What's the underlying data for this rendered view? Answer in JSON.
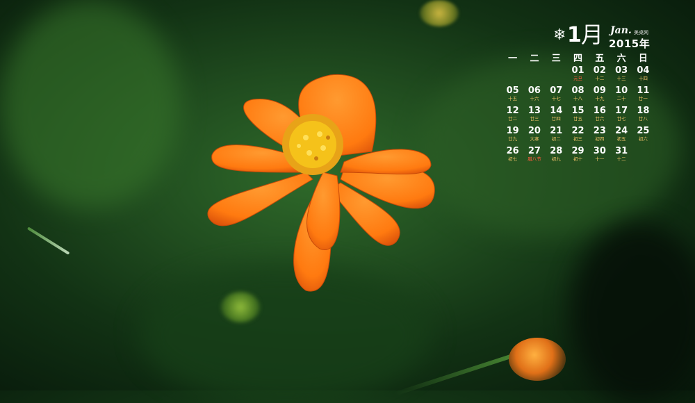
{
  "calendar": {
    "month_number": "1",
    "month_cn": "月",
    "month_en": "Jan.",
    "brand": "美桌网",
    "year": "2015年",
    "weekdays": [
      "一",
      "二",
      "三",
      "四",
      "五",
      "六",
      "日"
    ],
    "weeks": [
      [
        null,
        null,
        null,
        {
          "day": "01",
          "lunar": "元旦",
          "red": true
        },
        {
          "day": "02",
          "lunar": "十二"
        },
        {
          "day": "03",
          "lunar": "十三"
        },
        {
          "day": "04",
          "lunar": "十四"
        }
      ],
      [
        {
          "day": "05",
          "lunar": "十五"
        },
        {
          "day": "06",
          "lunar": "十六"
        },
        {
          "day": "07",
          "lunar": "十七"
        },
        {
          "day": "08",
          "lunar": "十八"
        },
        {
          "day": "09",
          "lunar": "十九"
        },
        {
          "day": "10",
          "lunar": "二十"
        },
        {
          "day": "11",
          "lunar": "廿一"
        }
      ],
      [
        {
          "day": "12",
          "lunar": "廿二"
        },
        {
          "day": "13",
          "lunar": "廿三"
        },
        {
          "day": "14",
          "lunar": "廿四"
        },
        {
          "day": "15",
          "lunar": "廿五"
        },
        {
          "day": "16",
          "lunar": "廿六"
        },
        {
          "day": "17",
          "lunar": "廿七"
        },
        {
          "day": "18",
          "lunar": "廿八"
        }
      ],
      [
        {
          "day": "19",
          "lunar": "廿九"
        },
        {
          "day": "20",
          "lunar": "大寒"
        },
        {
          "day": "21",
          "lunar": "初二"
        },
        {
          "day": "22",
          "lunar": "初三"
        },
        {
          "day": "23",
          "lunar": "初四"
        },
        {
          "day": "24",
          "lunar": "初五"
        },
        {
          "day": "25",
          "lunar": "初六"
        }
      ],
      [
        {
          "day": "26",
          "lunar": "初七"
        },
        {
          "day": "27",
          "lunar": "腊八节",
          "red": true
        },
        {
          "day": "28",
          "lunar": "初九"
        },
        {
          "day": "29",
          "lunar": "初十"
        },
        {
          "day": "30",
          "lunar": "十一"
        },
        {
          "day": "31",
          "lunar": "十二"
        },
        null
      ]
    ]
  },
  "colors": {
    "petal": "#ff7a10",
    "petal_dark": "#e0560a",
    "center": "#f5c21a",
    "lunar_text": "#f3c46a",
    "holiday_text": "#ff5a3c"
  },
  "icons": {
    "calendar_mark": "snowflake-icon"
  }
}
